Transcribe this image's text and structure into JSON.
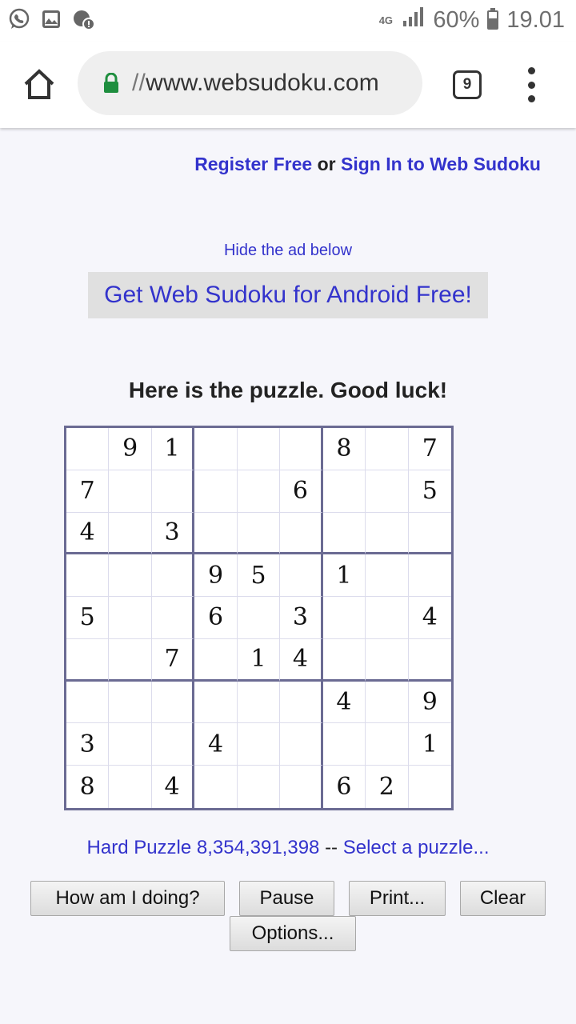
{
  "status_bar": {
    "network": "4G",
    "battery": "60%",
    "time": "19.01",
    "icons": [
      "whatsapp-icon",
      "gallery-icon",
      "notification-icon"
    ]
  },
  "browser": {
    "url_prefix": "//",
    "url_host": "www.websudoku.com",
    "tab_count": "9"
  },
  "page": {
    "register": "Register Free",
    "or": "or",
    "sign_in": "Sign In to Web Sudoku",
    "hide_ad": "Hide the ad below",
    "ad_text": "Get Web Sudoku for Android Free!",
    "title": "Here is the puzzle. Good luck!",
    "puzzle_label": "Hard Puzzle 8,354,391,398",
    "separator": "--",
    "select_puzzle": "Select a puzzle..."
  },
  "sudoku": [
    [
      "",
      "9",
      "1",
      "",
      "",
      "",
      "8",
      "",
      "7"
    ],
    [
      "7",
      "",
      "",
      "",
      "",
      "6",
      "",
      "",
      "5"
    ],
    [
      "4",
      "",
      "3",
      "",
      "",
      "",
      "",
      "",
      ""
    ],
    [
      "",
      "",
      "",
      "9",
      "5",
      "",
      "1",
      "",
      ""
    ],
    [
      "5",
      "",
      "",
      "6",
      "",
      "3",
      "",
      "",
      "4"
    ],
    [
      "",
      "",
      "7",
      "",
      "1",
      "4",
      "",
      "",
      ""
    ],
    [
      "",
      "",
      "",
      "",
      "",
      "",
      "4",
      "",
      "9"
    ],
    [
      "3",
      "",
      "",
      "4",
      "",
      "",
      "",
      "",
      "1"
    ],
    [
      "8",
      "",
      "4",
      "",
      "",
      "",
      "6",
      "2",
      ""
    ]
  ],
  "buttons": {
    "how": "How am I doing?",
    "pause": "Pause",
    "print": "Print...",
    "clear": "Clear",
    "options": "Options..."
  },
  "colors": {
    "link": "#3333cc",
    "grid_border": "#6b6b93",
    "lock": "#1e8e3e"
  }
}
